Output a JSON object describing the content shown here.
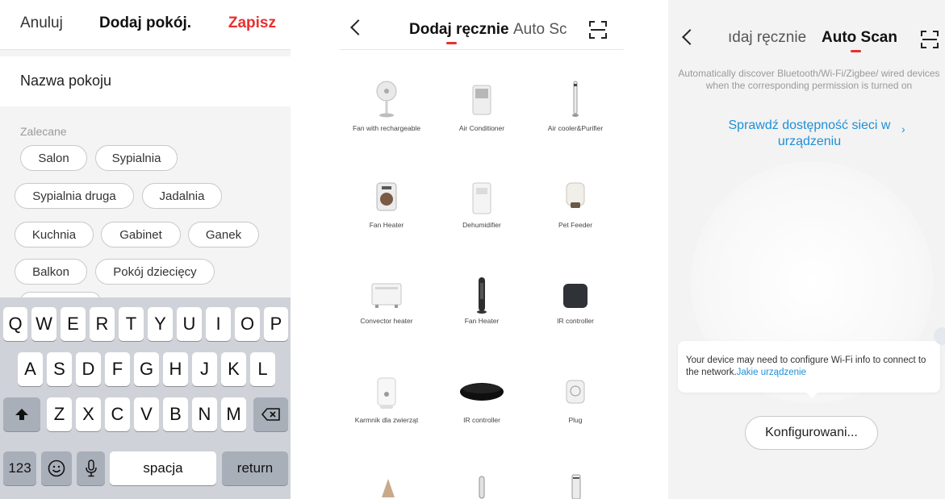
{
  "room_panel": {
    "cancel_label": "Anuluj",
    "title": "Dodaj pokój.",
    "save_label": "Zapisz",
    "name_placeholder": "Nazwa pokoju",
    "recommended_label": "Zalecane",
    "chips": [
      "Salon",
      "Sypialnia",
      "Sypialnia druga",
      "Jadalnia",
      "Kuchnia",
      "Gabinet",
      "Ganek",
      "Balkon",
      "Pokój dziecięcy"
    ]
  },
  "keyboard": {
    "row1": [
      "Q",
      "W",
      "E",
      "R",
      "T",
      "Y",
      "U",
      "I",
      "O",
      "P"
    ],
    "row2": [
      "A",
      "S",
      "D",
      "F",
      "G",
      "H",
      "J",
      "K",
      "L"
    ],
    "row3": [
      "Z",
      "X",
      "C",
      "V",
      "B",
      "N",
      "M"
    ],
    "numbers_label": "123",
    "space_label": "spacja",
    "return_label": "return"
  },
  "manual_panel": {
    "tab_manual": "Dodaj ręcznie",
    "tab_auto": "Auto Sc",
    "devices": [
      {
        "label": "Fan with rechargeable",
        "icon": "standing-fan-icon"
      },
      {
        "label": "Air Conditioner",
        "icon": "portable-ac-icon"
      },
      {
        "label": "Air cooler&Purifier",
        "icon": "tower-cooler-icon"
      },
      {
        "label": "Fan Heater",
        "icon": "fan-heater-icon"
      },
      {
        "label": "Dehumidifier",
        "icon": "dehumidifier-icon"
      },
      {
        "label": "Pet Feeder",
        "icon": "pet-feeder-icon"
      },
      {
        "label": "Convector heater",
        "icon": "convector-heater-icon"
      },
      {
        "label": "Fan Heater",
        "icon": "tower-heater-icon"
      },
      {
        "label": "IR controller",
        "icon": "ir-controller-square-icon"
      },
      {
        "label": "Karmnik dla zwierząt",
        "icon": "pet-feeder-white-icon"
      },
      {
        "label": "IR controller",
        "icon": "ir-controller-round-icon"
      },
      {
        "label": "Plug",
        "icon": "smart-plug-icon"
      }
    ]
  },
  "auto_panel": {
    "tab_manual": "ıdaj ręcznie",
    "tab_auto": "Auto Scan",
    "description": "Automatically discover Bluetooth/Wi-Fi/Zigbee/ wired devices when the corresponding permission is turned on",
    "check_network_link": "Sprawdź dostępność sieci w urządzeniu",
    "chevron": "›",
    "tooltip_text": "Your device may need to configure Wi-Fi info to connect to the network.",
    "tooltip_link": "Jakie urządzenie",
    "configure_button": "Konfigurowani..."
  },
  "colors": {
    "accent_red": "#e8302f",
    "link_blue": "#1e8fd6"
  }
}
